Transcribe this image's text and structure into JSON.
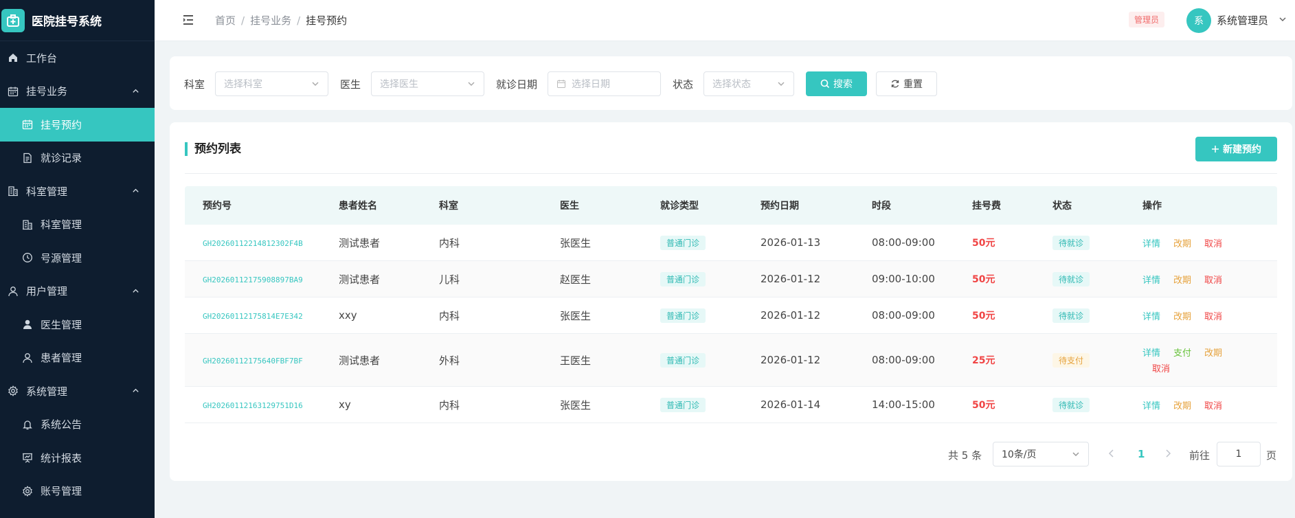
{
  "app": {
    "title": "医院挂号系统"
  },
  "sidebar": {
    "items": [
      {
        "label": "工作台",
        "icon": "home-icon",
        "level": 0
      },
      {
        "label": "挂号业务",
        "icon": "calendar-icon",
        "level": 0,
        "expanded": true
      },
      {
        "label": "挂号预约",
        "icon": "calendar-icon",
        "level": 1,
        "active": true
      },
      {
        "label": "就诊记录",
        "icon": "document-icon",
        "level": 1
      },
      {
        "label": "科室管理",
        "icon": "building-icon",
        "level": 0,
        "expanded": true
      },
      {
        "label": "科室管理",
        "icon": "building-icon",
        "level": 1
      },
      {
        "label": "号源管理",
        "icon": "clock-icon",
        "level": 1
      },
      {
        "label": "用户管理",
        "icon": "user-icon",
        "level": 0,
        "expanded": true
      },
      {
        "label": "医生管理",
        "icon": "user-filled-icon",
        "level": 1
      },
      {
        "label": "患者管理",
        "icon": "user-icon",
        "level": 1
      },
      {
        "label": "系统管理",
        "icon": "gear-icon",
        "level": 0,
        "expanded": true
      },
      {
        "label": "系统公告",
        "icon": "bell-icon",
        "level": 1
      },
      {
        "label": "统计报表",
        "icon": "chart-board-icon",
        "level": 1
      },
      {
        "label": "账号管理",
        "icon": "gear-icon",
        "level": 1
      }
    ]
  },
  "header": {
    "breadcrumb": [
      "首页",
      "挂号业务",
      "挂号预约"
    ],
    "role_badge": "管理员",
    "avatar_text": "系",
    "username": "系统管理员"
  },
  "filters": {
    "department_label": "科室",
    "department_placeholder": "选择科室",
    "doctor_label": "医生",
    "doctor_placeholder": "选择医生",
    "date_label": "就诊日期",
    "date_placeholder": "选择日期",
    "status_label": "状态",
    "status_placeholder": "选择状态",
    "search_label": "搜索",
    "reset_label": "重置"
  },
  "list": {
    "title": "预约列表",
    "new_button": "新建预约",
    "columns": [
      "预约号",
      "患者姓名",
      "科室",
      "医生",
      "就诊类型",
      "预约日期",
      "时段",
      "挂号费",
      "状态",
      "操作"
    ],
    "rows": [
      {
        "no": "GH20260112214812302F4B",
        "patient": "测试患者",
        "dept": "内科",
        "doctor": "张医生",
        "type": "普通门诊",
        "date": "2026-01-13",
        "slot": "08:00-09:00",
        "fee": "50元",
        "status": "待就诊",
        "status_kind": "wait",
        "ops": [
          "详情",
          "改期",
          "取消"
        ]
      },
      {
        "no": "GH20260112175908897BA9",
        "patient": "测试患者",
        "dept": "儿科",
        "doctor": "赵医生",
        "type": "普通门诊",
        "date": "2026-01-12",
        "slot": "09:00-10:00",
        "fee": "50元",
        "status": "待就诊",
        "status_kind": "wait",
        "ops": [
          "详情",
          "改期",
          "取消"
        ]
      },
      {
        "no": "GH20260112175814E7E342",
        "patient": "xxy",
        "dept": "内科",
        "doctor": "张医生",
        "type": "普通门诊",
        "date": "2026-01-12",
        "slot": "08:00-09:00",
        "fee": "50元",
        "status": "待就诊",
        "status_kind": "wait",
        "ops": [
          "详情",
          "改期",
          "取消"
        ]
      },
      {
        "no": "GH20260112175640FBF7BF",
        "patient": "测试患者",
        "dept": "外科",
        "doctor": "王医生",
        "type": "普通门诊",
        "date": "2026-01-12",
        "slot": "08:00-09:00",
        "fee": "25元",
        "status": "待支付",
        "status_kind": "pay",
        "ops": [
          "详情",
          "支付",
          "改期",
          "取消"
        ]
      },
      {
        "no": "GH20260112163129751D16",
        "patient": "xy",
        "dept": "内科",
        "doctor": "张医生",
        "type": "普通门诊",
        "date": "2026-01-14",
        "slot": "14:00-15:00",
        "fee": "50元",
        "status": "待就诊",
        "status_kind": "wait",
        "ops": [
          "详情",
          "改期",
          "取消"
        ]
      }
    ]
  },
  "pagination": {
    "total": "共 5 条",
    "page_size": "10条/页",
    "current": "1",
    "goto_label": "前往",
    "goto_value": "1",
    "goto_unit": "页"
  },
  "colors": {
    "accent": "#36c6c0",
    "sidebar_bg": "#0e1d2f",
    "danger": "#f04444",
    "warning": "#e6a23c",
    "success": "#67c23a"
  }
}
